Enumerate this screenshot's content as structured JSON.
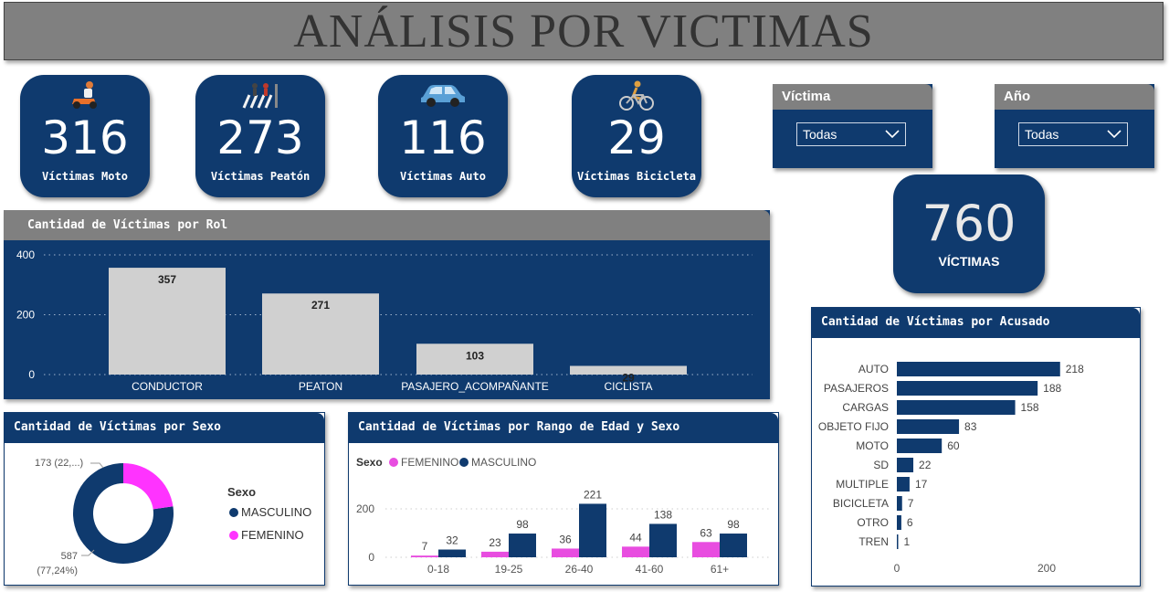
{
  "title": "ANÁLISIS POR VICTIMAS",
  "kpis": [
    {
      "value": "316",
      "label": "Víctimas Moto",
      "icon": "motorcycle-icon"
    },
    {
      "value": "273",
      "label": "Víctimas Peatón",
      "icon": "pedestrian-icon"
    },
    {
      "value": "116",
      "label": "Víctimas Auto",
      "icon": "car-icon"
    },
    {
      "value": "29",
      "label": "Víctimas Bicicleta",
      "icon": "bicycle-icon"
    }
  ],
  "slicers": [
    {
      "label": "Víctima",
      "value": "Todas"
    },
    {
      "label": "Año",
      "value": "Todas"
    }
  ],
  "total": {
    "value": "760",
    "label": "VÍCTIMAS"
  },
  "colors": {
    "navy": "#0f3a6e",
    "gray": "#808080",
    "light_bar": "#d0d0d0",
    "pink": "#e84de0",
    "white": "#ffffff"
  },
  "chart_data": [
    {
      "type": "bar",
      "title": "Cantidad de Víctimas por Rol",
      "categories": [
        "CONDUCTOR",
        "PEATON",
        "PASAJERO_ACOMPAÑANTE",
        "CICLISTA"
      ],
      "values": [
        357,
        271,
        103,
        29
      ],
      "yticks": [
        0,
        200,
        400
      ],
      "ylim": [
        0,
        400
      ],
      "grid": true
    },
    {
      "type": "pie",
      "title": "Cantidad de Víctimas por Sexo",
      "legend_title": "Sexo",
      "legend_position": "right",
      "categories": [
        "MASCULINO",
        "FEMENINO"
      ],
      "values": [
        587,
        173
      ],
      "slice_labels": [
        "587\n(77,24%)",
        "173 (22,...)"
      ],
      "colors": [
        "#0f3a6e",
        "#ff33ff"
      ]
    },
    {
      "type": "bar",
      "title": "Cantidad de Víctimas por Rango de Edad y Sexo",
      "legend_title": "Sexo",
      "legend_position": "top-left",
      "categories": [
        "0-18",
        "19-25",
        "26-40",
        "41-60",
        "61+"
      ],
      "series": [
        {
          "name": "FEMENINO",
          "values": [
            7,
            23,
            36,
            44,
            63
          ],
          "color": "#e84de0"
        },
        {
          "name": "MASCULINO",
          "values": [
            32,
            98,
            221,
            138,
            98
          ],
          "color": "#0f3a6e"
        }
      ],
      "yticks": [
        0,
        200
      ],
      "ylim": [
        0,
        240
      ]
    },
    {
      "type": "bar",
      "orientation": "horizontal",
      "title": "Cantidad de Víctimas por Acusado",
      "categories": [
        "AUTO",
        "PASAJEROS",
        "CARGAS",
        "OBJETO FIJO",
        "MOTO",
        "SD",
        "MULTIPLE",
        "BICICLETA",
        "OTRO",
        "TREN"
      ],
      "values": [
        218,
        188,
        158,
        83,
        60,
        22,
        17,
        7,
        6,
        1
      ],
      "xticks": [
        0,
        200
      ],
      "xlim": [
        0,
        240
      ]
    }
  ]
}
